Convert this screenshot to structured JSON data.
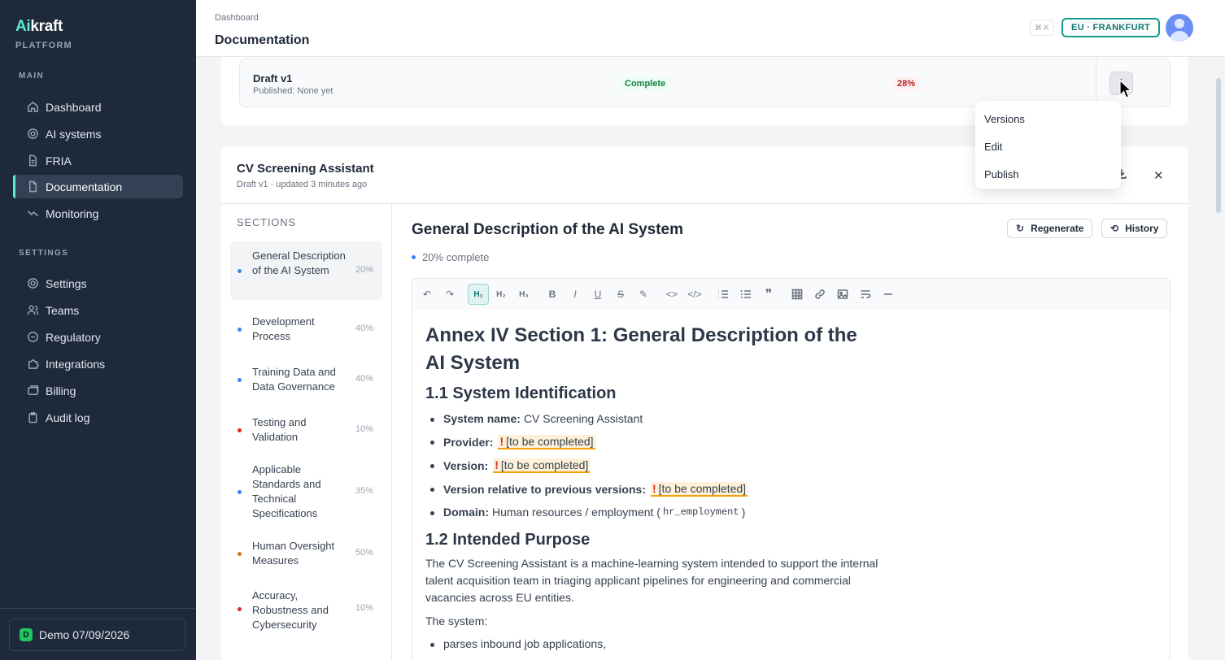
{
  "sidebar": {
    "brand_ai": "Ai",
    "brand_rest": "kraft",
    "brand_sub": "PLATFORM",
    "main_label": "MAIN",
    "settings_label": "SETTINGS",
    "main_items": [
      {
        "label": "Dashboard",
        "icon": "home-icon"
      },
      {
        "label": "AI systems",
        "icon": "cog-icon"
      },
      {
        "label": "FRIA",
        "icon": "file-icon"
      },
      {
        "label": "Documentation",
        "icon": "doc-icon",
        "active": true
      },
      {
        "label": "Monitoring",
        "icon": "trend-icon"
      }
    ],
    "settings_items": [
      {
        "label": "Settings",
        "icon": "gear-icon"
      },
      {
        "label": "Teams",
        "icon": "users-icon"
      },
      {
        "label": "Regulatory",
        "icon": "info-icon"
      },
      {
        "label": "Integrations",
        "icon": "puzzle-icon"
      },
      {
        "label": "Billing",
        "icon": "card-icon"
      },
      {
        "label": "Audit log",
        "icon": "clipboard-icon"
      }
    ],
    "demo": {
      "initial": "D",
      "label": "Demo 07/09/2026"
    }
  },
  "header": {
    "breadcrumb": "Dashboard",
    "title": "Documentation",
    "shortcut": "⌘ K",
    "region": "EU · FRANKFURT"
  },
  "version_row": {
    "name": "Draft v1",
    "published": "Published: None yet",
    "status": "Complete",
    "completion": "28%",
    "kebab": "⋮"
  },
  "menu": {
    "items": [
      "Versions",
      "Edit",
      "Publish"
    ]
  },
  "doc": {
    "title": "CV Screening Assistant",
    "subtitle": "Draft v1 · updated 3 minutes ago",
    "close": "✕",
    "sections_label": "SECTIONS",
    "sections": [
      {
        "name": "General Description of the AI System",
        "pct": "20%",
        "color": "#3b82f6",
        "active": true
      },
      {
        "name": "Development Process",
        "pct": "40%",
        "color": "#3b82f6"
      },
      {
        "name": "Training Data and Data Governance",
        "pct": "40%",
        "color": "#3b82f6"
      },
      {
        "name": "Testing and Validation",
        "pct": "10%",
        "color": "#dc2626"
      },
      {
        "name": "Applicable Standards and Technical Specifications",
        "pct": "35%",
        "color": "#3b82f6"
      },
      {
        "name": "Human Oversight Measures",
        "pct": "50%",
        "color": "#d97706"
      },
      {
        "name": "Accuracy, Robustness and Cybersecurity",
        "pct": "10%",
        "color": "#dc2626"
      }
    ],
    "editor": {
      "title": "General Description of the AI System",
      "progress": "20% complete",
      "regenerate": "Regenerate",
      "history": "History",
      "h1": "Annex IV Section 1: General Description of the AI System",
      "h2_identification": "1.1 System Identification",
      "h2_purpose": "1.2 Intended Purpose",
      "items": {
        "system_name_label": "System name:",
        "system_name_value": "CV Screening Assistant",
        "provider_label": "Provider:",
        "version_label": "Version:",
        "version_rel_label": "Version relative to previous versions:",
        "todo": "[to be completed]",
        "domain_label": "Domain:",
        "domain_value": "Human resources / employment (",
        "domain_code": "hr_employment",
        "domain_close": ")"
      },
      "purpose_para": "The CV Screening Assistant is a machine-learning system intended to support the internal talent acquisition team in triaging applicant pipelines for engineering and commercial vacancies across EU entities.",
      "the_system": "The system:",
      "system_bullet_1": "parses inbound job applications,"
    }
  }
}
